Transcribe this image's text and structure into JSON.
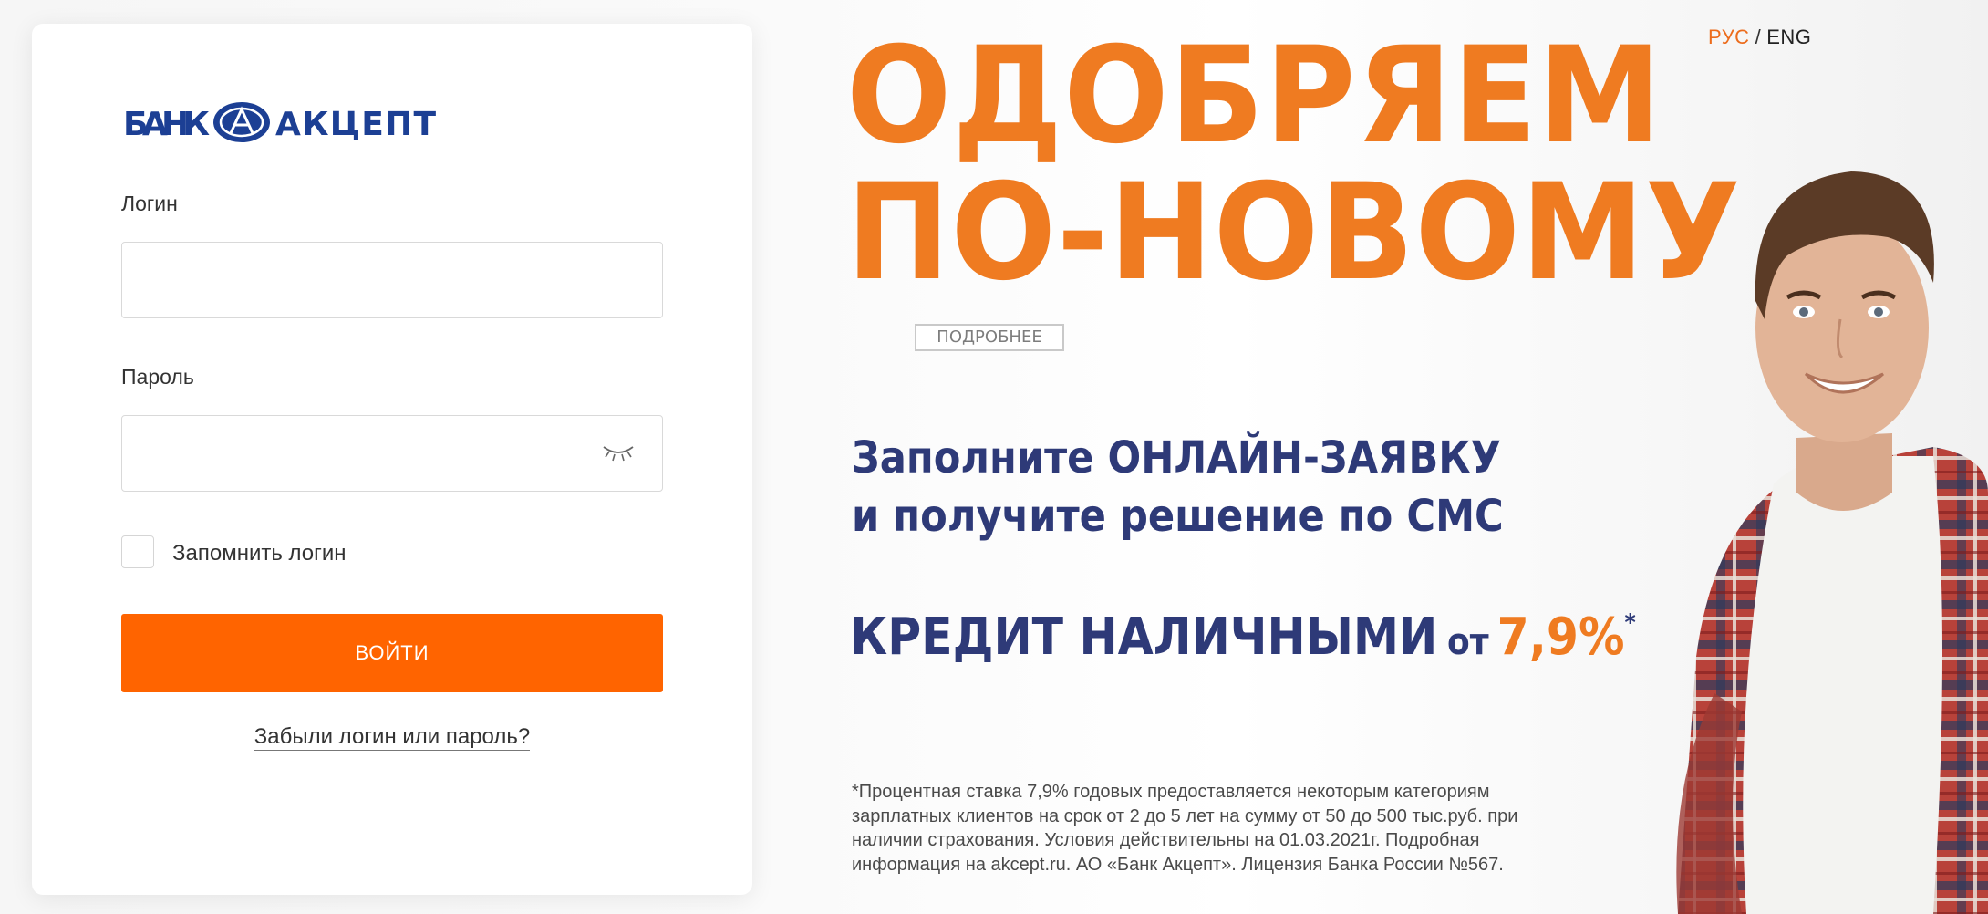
{
  "login": {
    "logo_text_left": "БАНК",
    "logo_text_right": "АКЦЕПТ",
    "login_label": "Логин",
    "login_value": "",
    "password_label": "Пароль",
    "password_value": "",
    "remember_label": "Запомнить логин",
    "remember_checked": false,
    "submit_label": "ВОЙТИ",
    "forgot_link": "Забыли логин или пароль?"
  },
  "language": {
    "active": "РУС",
    "separator": "/",
    "other": "ENG"
  },
  "promo": {
    "headline_line1": "ОДОБРЯЕМ",
    "headline_line2": "ПО-НОВОМУ",
    "more_button": "ПОДРОБНЕЕ",
    "subline_line1": "Заполните ОНЛАЙН-ЗАЯВКУ",
    "subline_line2": "и получите решение по СМС",
    "credit_text": "КРЕДИТ НАЛИЧНЫМИ",
    "credit_from": "от",
    "credit_rate": "7,9%",
    "credit_star": "*",
    "disclaimer": "*Процентная ставка 7,9% годовых предоставляется некоторым категориям зарплатных клиентов на срок от 2 до 5 лет на сумму от 50 до 500 тыс.руб. при наличии страхования. Условия действительны на 01.03.2021г. Подробная информация на akcept.ru. АО «Банк Акцепт». Лицензия Банка России №567."
  },
  "colors": {
    "accent_orange": "#ff6400",
    "headline_orange": "#ef7b21",
    "brand_blue": "#2e3a78",
    "logo_blue": "#1c3f94"
  }
}
